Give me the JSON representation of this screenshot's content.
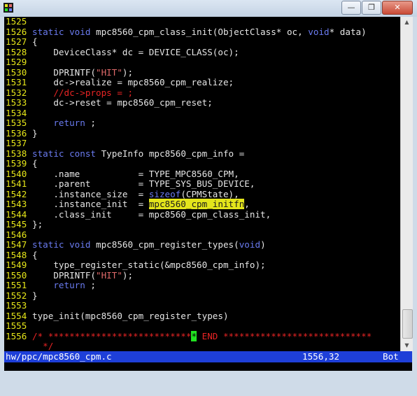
{
  "window": {
    "minimize_glyph": "—",
    "restore_glyph": "❐",
    "close_glyph": "✕"
  },
  "colors": {
    "background": "#000000",
    "text": "#e6e6e6",
    "line_number": "#e6e619",
    "keyword": "#6a7bf0",
    "string": "#e06a6a",
    "comment": "#e82424",
    "search_highlight": "#e3e51b",
    "cursor": "#21e321",
    "statusbar": "#1e3fd8"
  },
  "editor": {
    "lines": [
      {
        "n": "1525",
        "segs": []
      },
      {
        "n": "1526",
        "segs": [
          [
            "kw",
            "static void"
          ],
          [
            "t",
            " mpc8560_cpm_class_init(ObjectClass* oc, "
          ],
          [
            "kw",
            "void"
          ],
          [
            "t",
            "* data)"
          ]
        ]
      },
      {
        "n": "1527",
        "segs": [
          [
            "t",
            "{"
          ]
        ]
      },
      {
        "n": "1528",
        "segs": [
          [
            "t",
            "    DeviceClass* dc = DEVICE_CLASS(oc);"
          ]
        ]
      },
      {
        "n": "1529",
        "segs": []
      },
      {
        "n": "1530",
        "segs": [
          [
            "t",
            "    DPRINTF("
          ],
          [
            "str",
            "\"HIT\""
          ],
          [
            "t",
            ");"
          ]
        ]
      },
      {
        "n": "1531",
        "segs": [
          [
            "t",
            "    dc->realize = mpc8560_cpm_realize;"
          ]
        ]
      },
      {
        "n": "1532",
        "segs": [
          [
            "cm",
            "    //dc->props = ;"
          ]
        ]
      },
      {
        "n": "1533",
        "segs": [
          [
            "t",
            "    dc->reset = mpc8560_cpm_reset;"
          ]
        ]
      },
      {
        "n": "1534",
        "segs": []
      },
      {
        "n": "1535",
        "segs": [
          [
            "t",
            "    "
          ],
          [
            "kw",
            "return"
          ],
          [
            "t",
            " ;"
          ]
        ]
      },
      {
        "n": "1536",
        "segs": [
          [
            "t",
            "}"
          ]
        ]
      },
      {
        "n": "1537",
        "segs": []
      },
      {
        "n": "1538",
        "segs": [
          [
            "kw",
            "static const"
          ],
          [
            "t",
            " TypeInfo mpc8560_cpm_info ="
          ]
        ]
      },
      {
        "n": "1539",
        "segs": [
          [
            "t",
            "{"
          ]
        ]
      },
      {
        "n": "1540",
        "segs": [
          [
            "t",
            "    .name           = TYPE_MPC8560_CPM,"
          ]
        ]
      },
      {
        "n": "1541",
        "segs": [
          [
            "t",
            "    .parent         = TYPE_SYS_BUS_DEVICE,"
          ]
        ]
      },
      {
        "n": "1542",
        "segs": [
          [
            "t",
            "    .instance_size  = "
          ],
          [
            "kw",
            "sizeof"
          ],
          [
            "t",
            "(CPMState),"
          ]
        ]
      },
      {
        "n": "1543",
        "segs": [
          [
            "t",
            "    .instance_init  = "
          ],
          [
            "hl",
            "mpc8560_cpm_initfn"
          ],
          [
            "t",
            ","
          ]
        ]
      },
      {
        "n": "1544",
        "segs": [
          [
            "t",
            "    .class_init     = mpc8560_cpm_class_init,"
          ]
        ]
      },
      {
        "n": "1545",
        "segs": [
          [
            "t",
            "};"
          ]
        ]
      },
      {
        "n": "1546",
        "segs": []
      },
      {
        "n": "1547",
        "segs": [
          [
            "kw",
            "static void"
          ],
          [
            "t",
            " mpc8560_cpm_register_types("
          ],
          [
            "kw",
            "void"
          ],
          [
            "t",
            ")"
          ]
        ]
      },
      {
        "n": "1548",
        "segs": [
          [
            "t",
            "{"
          ]
        ]
      },
      {
        "n": "1549",
        "segs": [
          [
            "t",
            "    type_register_static(&mpc8560_cpm_info);"
          ]
        ]
      },
      {
        "n": "1550",
        "segs": [
          [
            "t",
            "    DPRINTF("
          ],
          [
            "str",
            "\"HIT\""
          ],
          [
            "t",
            ");"
          ]
        ]
      },
      {
        "n": "1551",
        "segs": [
          [
            "t",
            "    "
          ],
          [
            "kw",
            "return"
          ],
          [
            "t",
            " ;"
          ]
        ]
      },
      {
        "n": "1552",
        "segs": [
          [
            "t",
            "}"
          ]
        ]
      },
      {
        "n": "1553",
        "segs": []
      },
      {
        "n": "1554",
        "segs": [
          [
            "t",
            "type_init(mpc8560_cpm_register_types)"
          ]
        ]
      },
      {
        "n": "1555",
        "segs": []
      },
      {
        "n": "1556",
        "segs": [
          [
            "cm",
            "/* ***************************"
          ],
          [
            "cur",
            "*"
          ],
          [
            "cm",
            " END ****************************"
          ]
        ]
      },
      {
        "n": "",
        "segs": [
          [
            "cm",
            "  */"
          ]
        ]
      }
    ]
  },
  "statusbar": {
    "filename": "hw/ppc/mpc8560_cpm.c",
    "position": "1556,32",
    "scroll": "Bot"
  },
  "scrollbar": {
    "up_arrow": "▲",
    "down_arrow": "▼"
  }
}
